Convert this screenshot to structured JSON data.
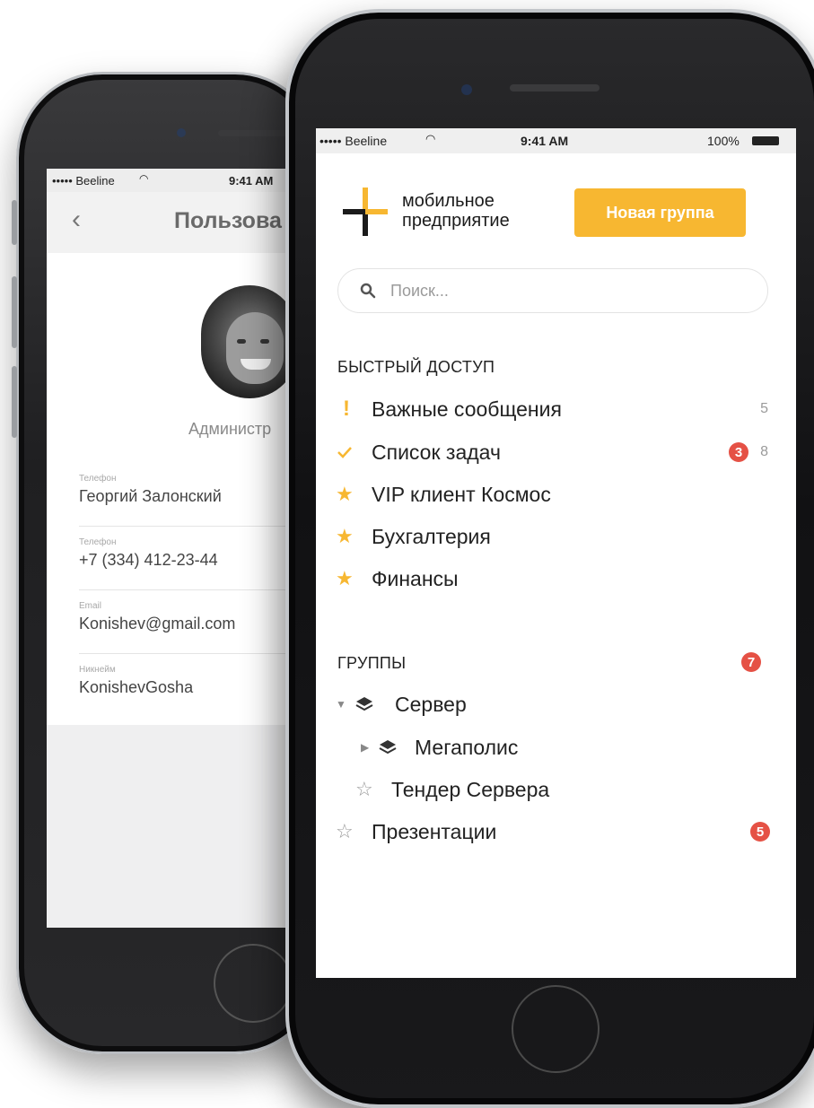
{
  "back_screen": {
    "status": {
      "carrier": "••••• Beeline",
      "time": "9:41 AM"
    },
    "nav": {
      "back_icon": "chevron-left-icon",
      "title": "Пользова"
    },
    "role": "Администр",
    "fields": [
      {
        "label": "Телефон",
        "value": "Георгий Залонский"
      },
      {
        "label": "Телефон",
        "value": "+7 (334) 412-23-44"
      },
      {
        "label": "Email",
        "value": "Konishev@gmail.com"
      },
      {
        "label": "Никнейм",
        "value": "KonishevGosha"
      }
    ]
  },
  "front_screen": {
    "status": {
      "carrier": "••••• Beeline",
      "time": "9:41 AM",
      "battery": "100%"
    },
    "logo": {
      "line1": "мобильное",
      "line2": "предприятие",
      "icon": "plus-logo-icon"
    },
    "new_group_button": "Новая группа",
    "search": {
      "placeholder": "Поиск...",
      "icon": "search-icon"
    },
    "quick_access": {
      "title": "БЫСТРЫЙ ДОСТУП",
      "items": [
        {
          "label": "Важные сообщения",
          "icon": "exclamation-icon",
          "count": "5"
        },
        {
          "label": "Список задач",
          "icon": "check-icon",
          "badge": "3",
          "count": "8"
        },
        {
          "label": "VIP клиент Космос",
          "icon": "star-icon"
        },
        {
          "label": "Бухгалтерия",
          "icon": "star-icon"
        },
        {
          "label": "Финансы",
          "icon": "star-icon"
        }
      ]
    },
    "groups": {
      "title": "ГРУППЫ",
      "badge": "7",
      "items": [
        {
          "label": "Сервер",
          "icon": "layers-icon",
          "expander": "caret-down-icon"
        },
        {
          "label": "Мегаполис",
          "icon": "layers-icon",
          "expander": "caret-right-icon"
        },
        {
          "label": "Тендер Сервера",
          "icon": "star-outline-icon"
        },
        {
          "label": "Презентации",
          "icon": "star-outline-icon",
          "badge": "5"
        }
      ]
    }
  },
  "colors": {
    "accent": "#f7b731",
    "badge": "#e55145",
    "count": "#9a9a9a"
  }
}
